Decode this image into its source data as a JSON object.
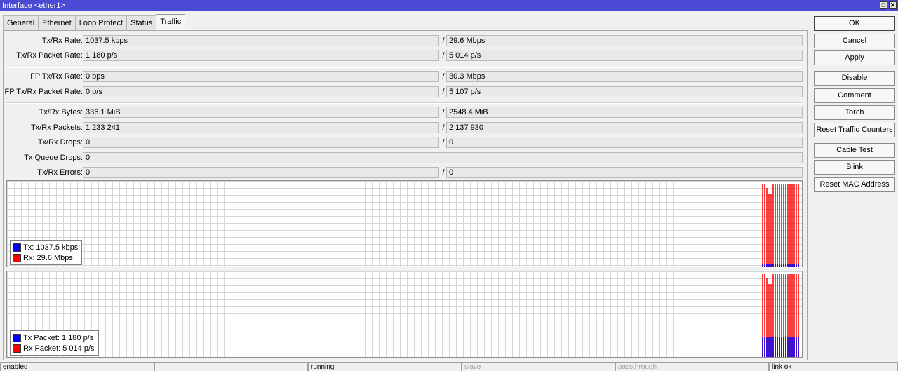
{
  "window": {
    "title": "Interface <ether1>",
    "controls": [
      "□",
      "✕"
    ]
  },
  "tabs": [
    "General",
    "Ethernet",
    "Loop Protect",
    "Status",
    "Traffic"
  ],
  "active_tab": "Traffic",
  "fields": {
    "rate": {
      "label": "Tx/Rx Rate:",
      "tx": "1037.5 kbps",
      "rx": "29.6 Mbps"
    },
    "packet_rate": {
      "label": "Tx/Rx Packet Rate:",
      "tx": "1 180 p/s",
      "rx": "5 014 p/s"
    },
    "fp_rate": {
      "label": "FP Tx/Rx Rate:",
      "tx": "0 bps",
      "rx": "30.3 Mbps"
    },
    "fp_packet_rate": {
      "label": "FP Tx/Rx Packet Rate:",
      "tx": "0 p/s",
      "rx": "5 107 p/s"
    },
    "bytes": {
      "label": "Tx/Rx Bytes:",
      "tx": "336.1 MiB",
      "rx": "2548.4 MiB"
    },
    "packets": {
      "label": "Tx/Rx Packets:",
      "tx": "1 233 241",
      "rx": "2 137 930"
    },
    "drops": {
      "label": "Tx/Rx Drops:",
      "tx": "0",
      "rx": "0"
    },
    "queue_drops": {
      "label": "Tx Queue Drops:",
      "value": "0"
    },
    "errors": {
      "label": "Tx/Rx Errors:",
      "tx": "0",
      "rx": "0"
    },
    "slash": "/"
  },
  "graph_rate": {
    "legend_tx": "Tx:  1037.5 kbps",
    "legend_rx": "Rx:  29.6 Mbps",
    "tx_color": "#0000ff",
    "rx_color": "#ff0000"
  },
  "graph_packets": {
    "legend_tx": "Tx Packet:  1 180 p/s",
    "legend_rx": "Rx Packet:  5 014 p/s",
    "tx_color": "#0000ff",
    "rx_color": "#ff0000"
  },
  "buttons": {
    "ok": "OK",
    "cancel": "Cancel",
    "apply": "Apply",
    "disable": "Disable",
    "comment": "Comment",
    "torch": "Torch",
    "reset_counters": "Reset Traffic Counters",
    "cable_test": "Cable Test",
    "blink": "Blink",
    "reset_mac": "Reset MAC Address"
  },
  "status_bar": [
    "enabled",
    "",
    "running",
    "slave",
    "passthrough",
    "link ok"
  ]
}
